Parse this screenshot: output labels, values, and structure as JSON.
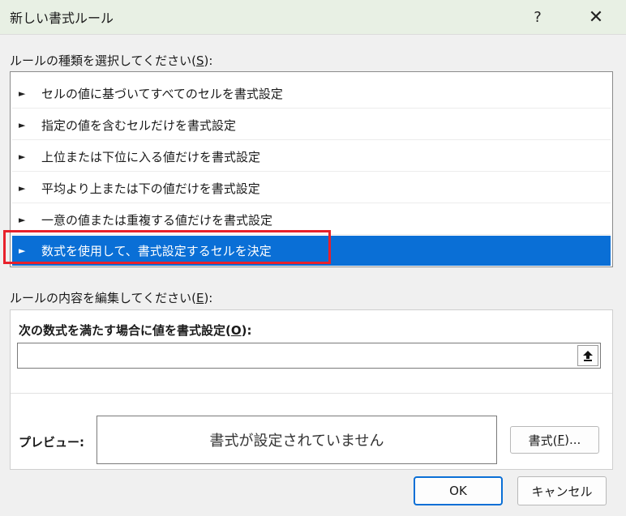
{
  "window": {
    "title": "新しい書式ルール",
    "help_glyph": "?",
    "close_glyph": "✕"
  },
  "rule_type": {
    "label_prefix": "ルールの種類を選択してください(",
    "label_key": "S",
    "label_suffix": "):",
    "items": [
      {
        "label": "セルの値に基づいてすべてのセルを書式設定",
        "selected": false
      },
      {
        "label": "指定の値を含むセルだけを書式設定",
        "selected": false
      },
      {
        "label": "上位または下位に入る値だけを書式設定",
        "selected": false
      },
      {
        "label": "平均より上または下の値だけを書式設定",
        "selected": false
      },
      {
        "label": "一意の値または重複する値だけを書式設定",
        "selected": false
      },
      {
        "label": "数式を使用して、書式設定するセルを決定",
        "selected": true
      }
    ]
  },
  "edit": {
    "label_prefix": "ルールの内容を編集してください(",
    "label_key": "E",
    "label_suffix": "):",
    "formula_label_prefix": "次の数式を満たす場合に値を書式設定(",
    "formula_label_key": "O",
    "formula_label_suffix": "):",
    "formula_value": "",
    "collapse_icon": "arrow-up-icon",
    "preview_label": "プレビュー:",
    "preview_text": "書式が設定されていません",
    "format_button_prefix": "書式(",
    "format_button_key": "F",
    "format_button_suffix": ")..."
  },
  "footer": {
    "ok_label": "OK",
    "cancel_label": "キャンセル"
  },
  "colors": {
    "selection": "#0a6fd6",
    "highlight": "#e8212b",
    "titlebar": "#e8f0e4"
  }
}
